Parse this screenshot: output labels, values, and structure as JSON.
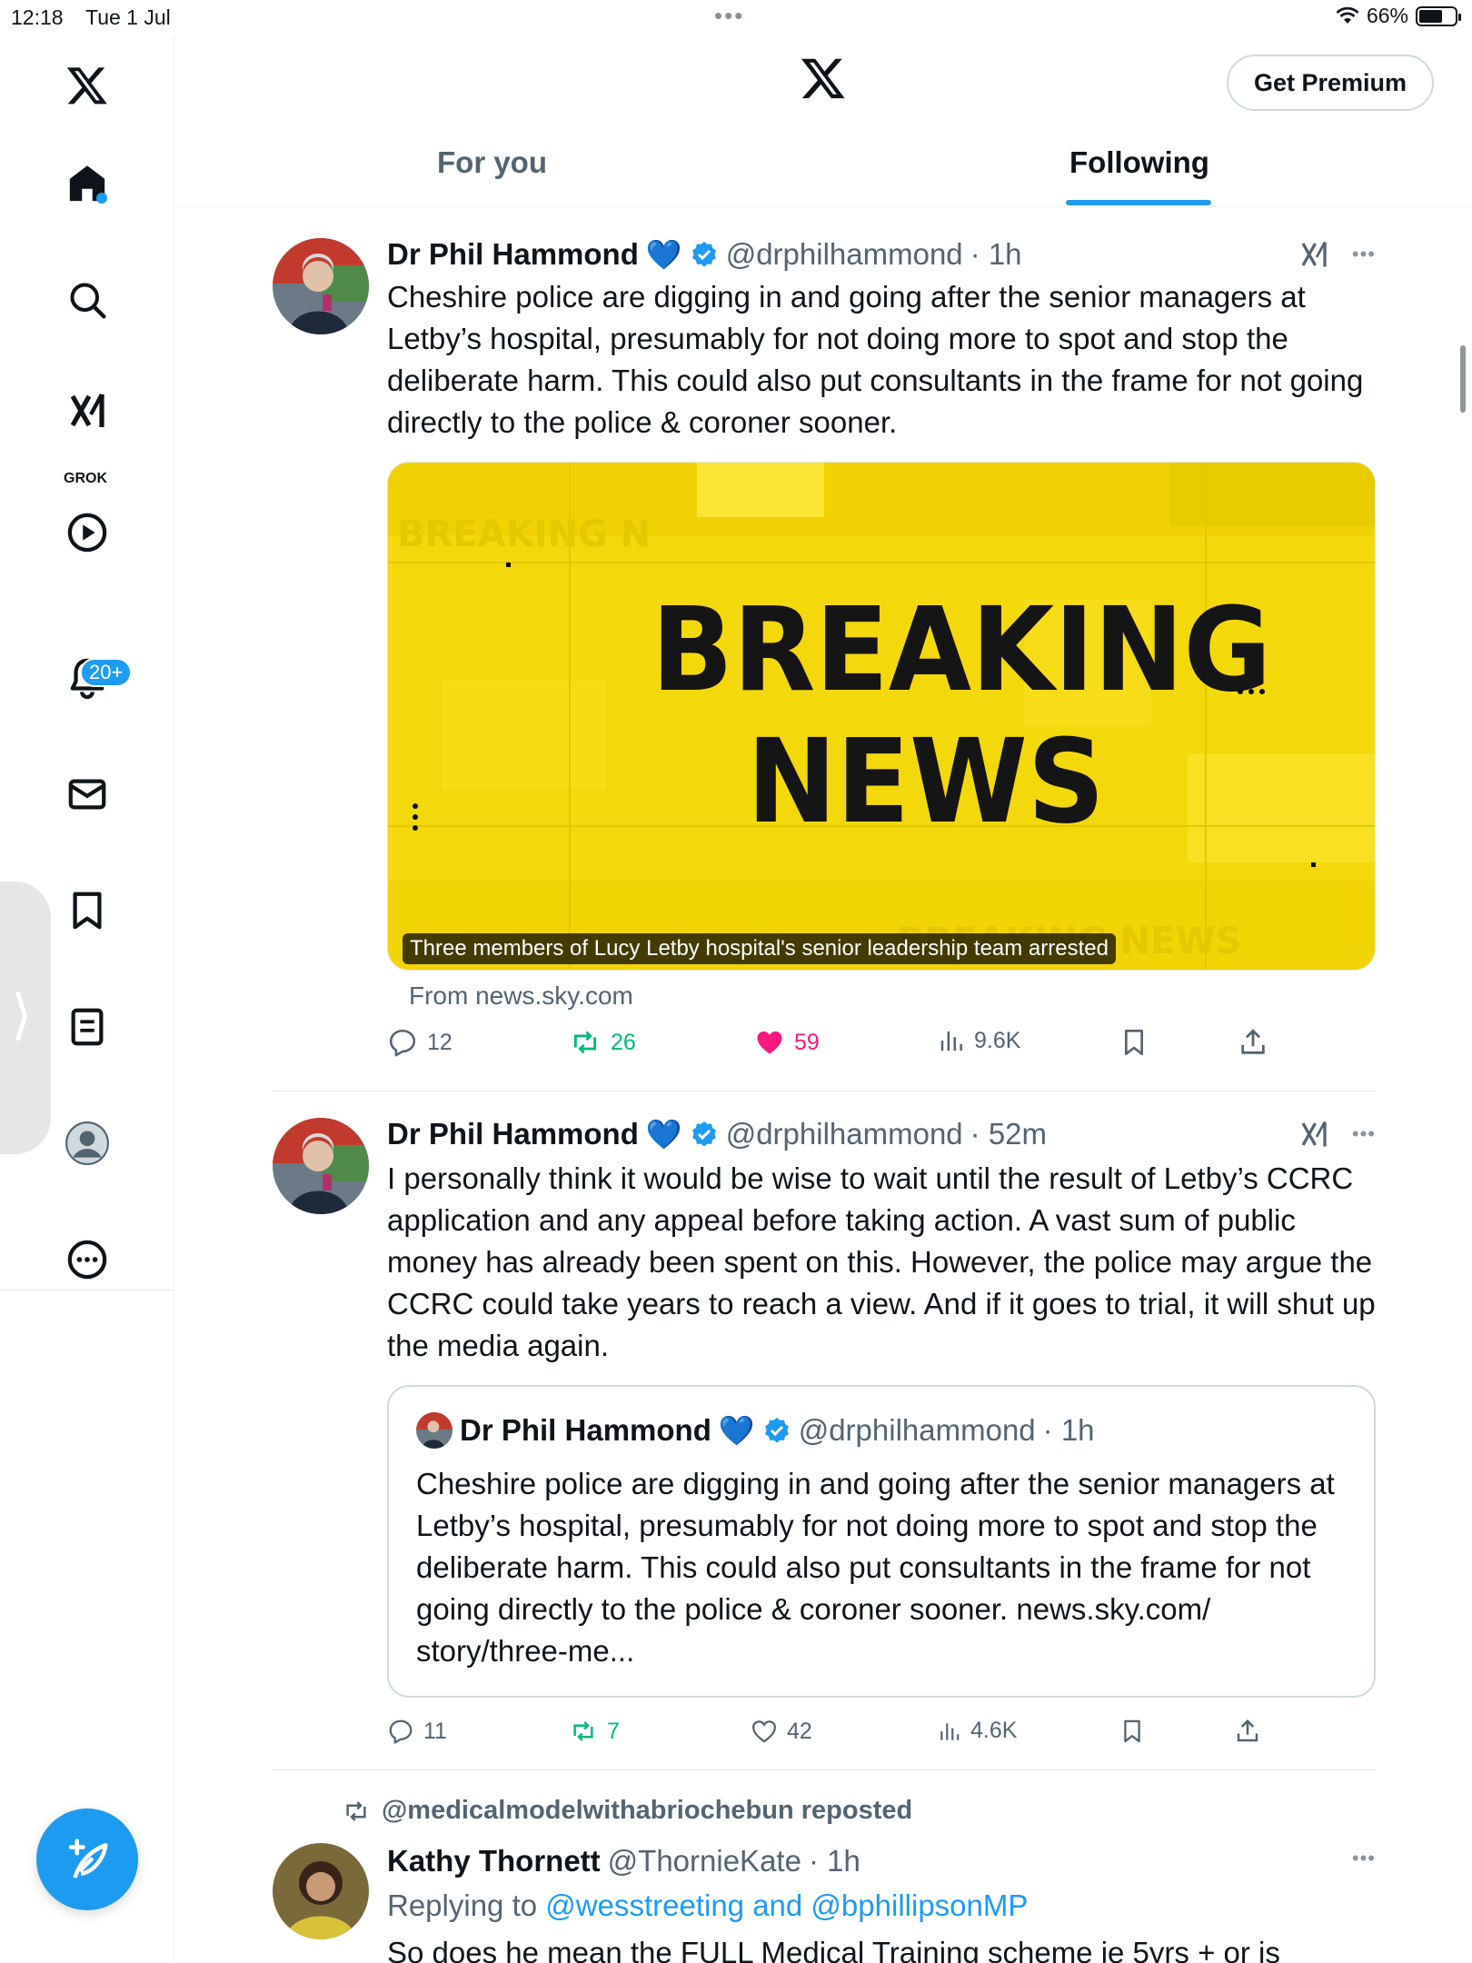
{
  "status_bar": {
    "time": "12:18",
    "date": "Tue 1 Jul",
    "battery": "66%"
  },
  "sidebar": {
    "grok_label": "GROK",
    "notifications_badge": "20+"
  },
  "header": {
    "premium_label": "Get Premium",
    "tabs": [
      {
        "label": "For you"
      },
      {
        "label": "Following"
      }
    ]
  },
  "tweets": [
    {
      "name": "Dr Phil Hammond",
      "heart": "💙",
      "handle": "@drphilhammond",
      "time": "· 1h",
      "text": "Cheshire police are digging in and going after the senior managers at Letby’s  hospital, presumably for not doing more to spot and stop the deliberate harm. This could also put consultants in the frame for not going directly to the police & coroner sooner.",
      "media": {
        "headline_1": "BREAKING",
        "headline_2": "NEWS",
        "caption": "Three members of Lucy Letby hospital's senior leadership team arrested",
        "from": "From news.sky.com"
      },
      "stats": {
        "replies": "12",
        "reposts": "26",
        "likes": "59",
        "views": "9.6K"
      }
    },
    {
      "name": "Dr Phil Hammond",
      "heart": "💙",
      "handle": "@drphilhammond",
      "time": "· 52m",
      "text": "I personally think it would be wise to wait until the result of Letby’s CCRC application and any appeal before taking action. A vast sum of public money has already been spent on this. However, the police may argue the CCRC  could take years to reach a view. And if it goes to trial, it will shut up the media again.",
      "quote": {
        "name": "Dr Phil Hammond",
        "heart": "💙",
        "handle": "@drphilhammond",
        "time": "· 1h",
        "text": "Cheshire police are digging in and going after the senior managers at Letby’s  hospital, presumably for not doing more to spot and stop the deliberate harm. This could also put consultants in the frame for not going directly to the police & coroner sooner. news.sky.com/ story/three-me..."
      },
      "stats": {
        "replies": "11",
        "reposts": "7",
        "likes": "42",
        "views": "4.6K"
      }
    },
    {
      "reposted_by": "@medicalmodelwithabriochebun reposted",
      "name": "Kathy Thornett",
      "handle": "@ThornieKate",
      "time": "· 1h",
      "replying_label": "Replying to",
      "replying_to": "@wesstreeting and @bphillipsonMP",
      "text": "So does he mean the FULL Medical Training scheme ie 5yrs + or is"
    }
  ]
}
